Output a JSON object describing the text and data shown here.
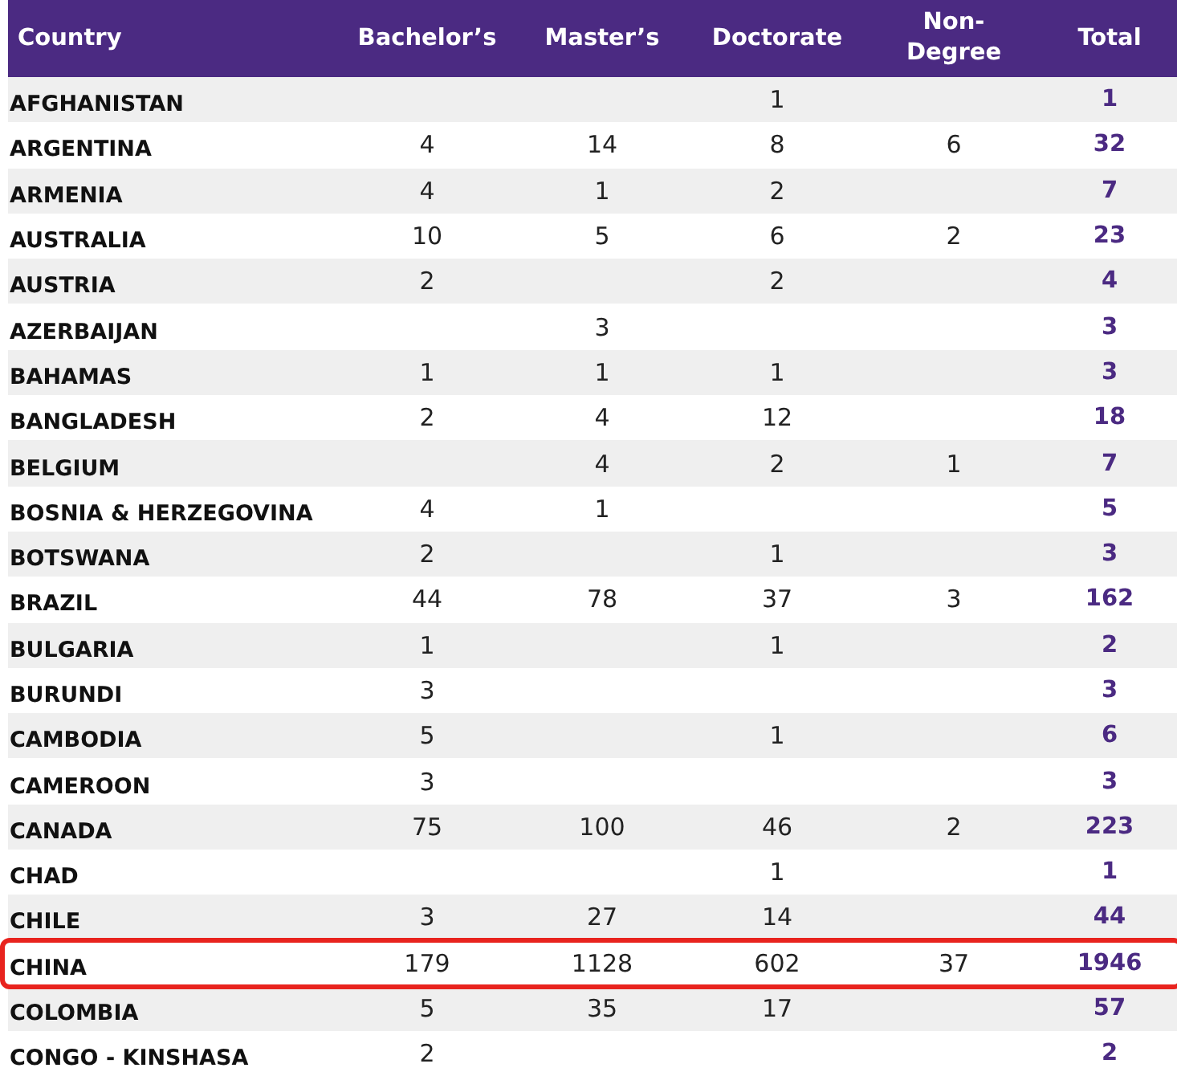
{
  "table": {
    "columns": [
      "Country",
      "Bachelor’s",
      "Master’s",
      "Doctorate",
      "Non-\nDegree",
      "Total"
    ],
    "rows": [
      {
        "cells": [
          "AFGHANISTAN",
          "",
          "",
          "1",
          "",
          "1"
        ],
        "highlighted": false
      },
      {
        "cells": [
          "ARGENTINA",
          "4",
          "14",
          "8",
          "6",
          "32"
        ],
        "highlighted": false
      },
      {
        "cells": [
          "ARMENIA",
          "4",
          "1",
          "2",
          "",
          "7"
        ],
        "highlighted": false
      },
      {
        "cells": [
          "AUSTRALIA",
          "10",
          "5",
          "6",
          "2",
          "23"
        ],
        "highlighted": false
      },
      {
        "cells": [
          "AUSTRIA",
          "2",
          "",
          "2",
          "",
          "4"
        ],
        "highlighted": false
      },
      {
        "cells": [
          "AZERBAIJAN",
          "",
          "3",
          "",
          "",
          "3"
        ],
        "highlighted": false
      },
      {
        "cells": [
          "BAHAMAS",
          "1",
          "1",
          "1",
          "",
          "3"
        ],
        "highlighted": false
      },
      {
        "cells": [
          "BANGLADESH",
          "2",
          "4",
          "12",
          "",
          "18"
        ],
        "highlighted": false
      },
      {
        "cells": [
          "BELGIUM",
          "",
          "4",
          "2",
          "1",
          "7"
        ],
        "highlighted": false
      },
      {
        "cells": [
          "BOSNIA & HERZEGOVINA",
          "4",
          "1",
          "",
          "",
          "5"
        ],
        "highlighted": false
      },
      {
        "cells": [
          "BOTSWANA",
          "2",
          "",
          "1",
          "",
          "3"
        ],
        "highlighted": false
      },
      {
        "cells": [
          "BRAZIL",
          "44",
          "78",
          "37",
          "3",
          "162"
        ],
        "highlighted": false
      },
      {
        "cells": [
          "BULGARIA",
          "1",
          "",
          "1",
          "",
          "2"
        ],
        "highlighted": false
      },
      {
        "cells": [
          "BURUNDI",
          "3",
          "",
          "",
          "",
          "3"
        ],
        "highlighted": false
      },
      {
        "cells": [
          "CAMBODIA",
          "5",
          "",
          "1",
          "",
          "6"
        ],
        "highlighted": false
      },
      {
        "cells": [
          "CAMEROON",
          "3",
          "",
          "",
          "",
          "3"
        ],
        "highlighted": false
      },
      {
        "cells": [
          "CANADA",
          "75",
          "100",
          "46",
          "2",
          "223"
        ],
        "highlighted": false
      },
      {
        "cells": [
          "CHAD",
          "",
          "",
          "1",
          "",
          "1"
        ],
        "highlighted": false
      },
      {
        "cells": [
          "CHILE",
          "3",
          "27",
          "14",
          "",
          "44"
        ],
        "highlighted": false
      },
      {
        "cells": [
          "CHINA",
          "179",
          "1128",
          "602",
          "37",
          "1946"
        ],
        "highlighted": true
      },
      {
        "cells": [
          "COLOMBIA",
          "5",
          "35",
          "17",
          "",
          "57"
        ],
        "highlighted": false
      },
      {
        "cells": [
          "CONGO - KINSHASA",
          "2",
          "",
          "",
          "",
          "2"
        ],
        "highlighted": false
      }
    ]
  }
}
